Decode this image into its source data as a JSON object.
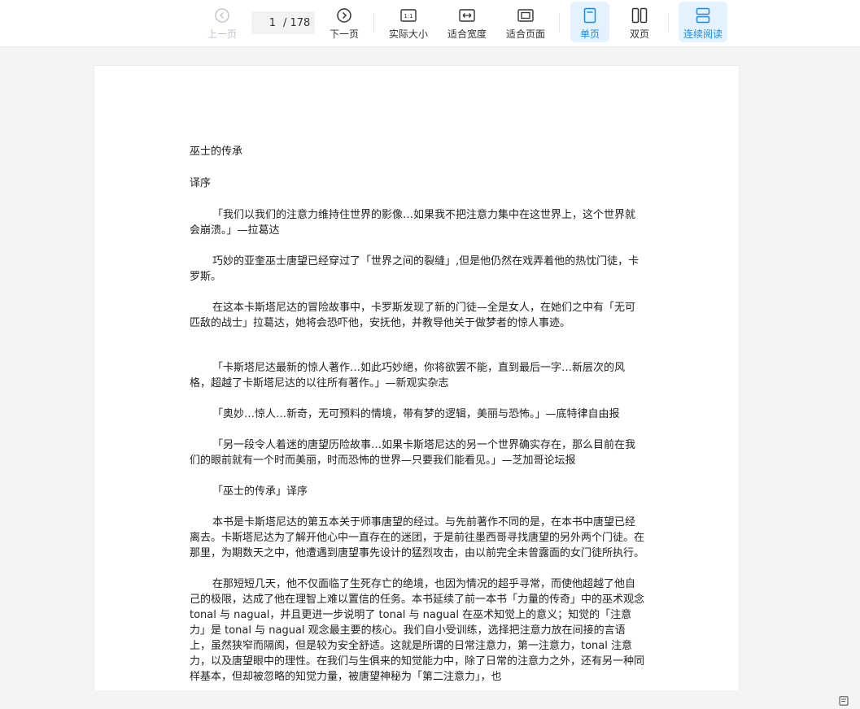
{
  "toolbar": {
    "prev_label": "上一页",
    "current_page": "1",
    "total_pages": "/ 178",
    "next_label": "下一页",
    "actual_size_label": "实际大小",
    "fit_width_label": "适合宽度",
    "fit_page_label": "适合页面",
    "single_page_label": "单页",
    "double_page_label": "双页",
    "continuous_label": "连续阅读",
    "actual_size_icon_text": "1:1"
  },
  "document": {
    "title": "巫士的传承",
    "subtitle": "译序",
    "paragraphs": [
      "「我们以我们的注意力维持住世界的影像…如果我不把注意力集中在这世界上，这个世界就会崩溃。」—拉葛达",
      "巧妙的亚奎巫士唐望已经穿过了「世界之间的裂缝」,但是他仍然在戏弄着他的热忱门徒，卡罗斯。",
      "在这本卡斯塔尼达的冒险故事中，卡罗斯发现了新的门徒—全是女人，在她们之中有「无可匹敌的战士」拉葛达，她将会恐吓他，安抚他，并教导他关于做梦者的惊人事迹。",
      "「卡斯塔尼达最新的惊人著作…如此巧妙絕，你将欲罢不能，直到最后一字…新层次的风格，超越了卡斯塔尼达的以往所有著作。」—新观实杂志",
      "「奥妙…惊人…新奇，无可预料的情境，带有梦的逻辑，美丽与恐怖。」—底特律自由报",
      "「另一段令人着迷的唐望历险故事…如果卡斯塔尼达的另一个世界确实存在，那么目前在我们的眼前就有一个时而美丽，时而恐怖的世界—只要我们能看见。」—芝加哥论坛报",
      "「巫士的传承」译序",
      "本书是卡斯塔尼达的第五本关于师事唐望的经过。与先前著作不同的是，在本书中唐望已经离去。卡斯塔尼达为了解开他心中一直存在的迷团，于是前往墨西哥寻找唐望的另外两个门徒。在那里，为期数天之中，他遭遇到唐望事先设计的猛烈攻击，由以前完全未曾露面的女门徒所执行。",
      "在那短短几天，他不仅面临了生死存亡的绝境，也因为情况的超乎寻常，而使他超越了他自己的极限，达成了他在理智上难以置信的任务。本书延续了前一本书「力量的传奇」中的巫术观念 tonal 与 nagual，并且更进一步说明了 tonal 与 nagual 在巫术知觉上的意义；知觉的「注意力」是 tonal 与 nagual 观念最主要的核心。我们自小受训练，选择把注意力放在间接的言语上，虽然狭窄而隔阂，但是较为安全舒适。这就是所谓的日常注意力，第一注意力，tonal 注意力，以及唐望眼中的理性。在我们与生俱来的知觉能力中，除了日常的注意力之外，还有另一种同样基本，但却被忽略的知觉力量，被唐望神秘为「第二注意力」，也"
    ]
  },
  "colors": {
    "accent": "#1e8ae8",
    "active_bg": "#e4f2ff",
    "disabled": "#c0c4cc",
    "text": "#222222",
    "background": "#f3f4f6"
  },
  "icons": {
    "prev": "chevron-left-circle-icon",
    "next": "chevron-right-circle-icon",
    "actual_size": "one-to-one-icon",
    "fit_width": "fit-width-icon",
    "fit_page": "fit-page-icon",
    "single_page": "single-page-icon",
    "double_page": "double-page-icon",
    "continuous": "continuous-scroll-icon",
    "notes": "notes-icon"
  }
}
